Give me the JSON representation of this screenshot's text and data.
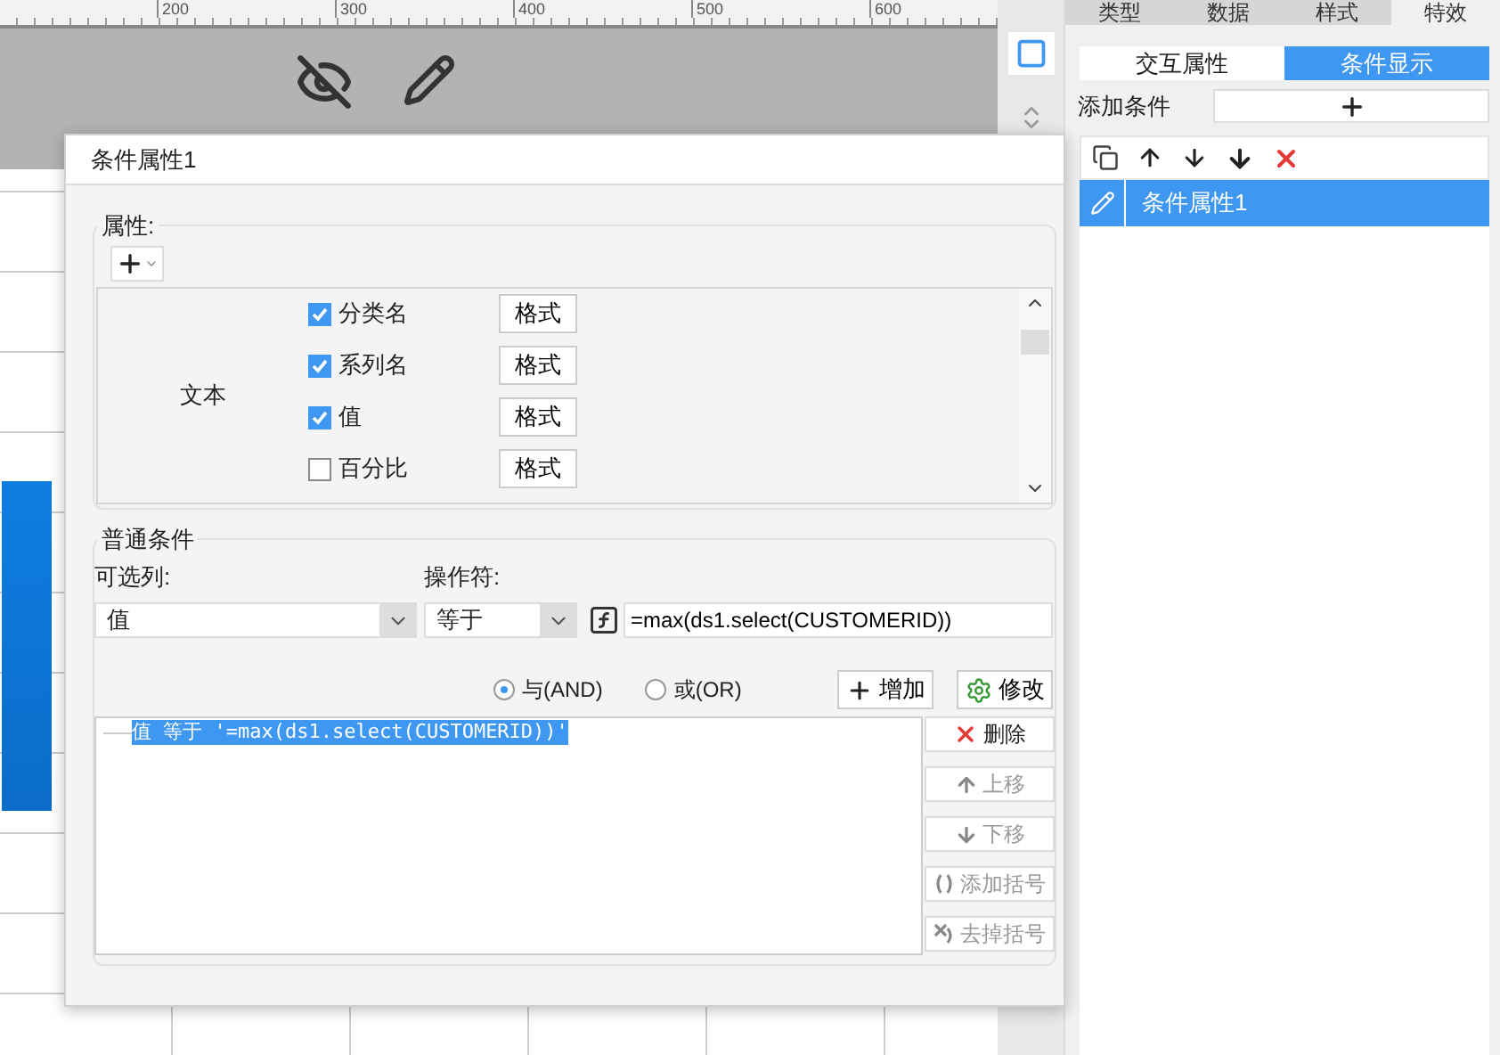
{
  "ruler": {
    "labels": [
      "200",
      "300",
      "400",
      "500",
      "600"
    ]
  },
  "panel": {
    "tabs": [
      {
        "label": "类型",
        "selected": false
      },
      {
        "label": "数据",
        "selected": false
      },
      {
        "label": "样式",
        "selected": false
      },
      {
        "label": "特效",
        "selected": true
      }
    ],
    "sub_tabs": [
      {
        "label": "交互属性",
        "selected": false
      },
      {
        "label": "条件显示",
        "selected": true
      }
    ],
    "add_label": "添加条件",
    "conditions": [
      {
        "label": "条件属性1",
        "selected": true
      }
    ]
  },
  "dialog": {
    "title": "条件属性1",
    "properties": {
      "legend": "属性:",
      "group": "文本",
      "items": [
        {
          "label": "分类名",
          "checked": true,
          "button": "格式"
        },
        {
          "label": "系列名",
          "checked": true,
          "button": "格式"
        },
        {
          "label": "值",
          "checked": true,
          "button": "格式"
        },
        {
          "label": "百分比",
          "checked": false,
          "button": "格式"
        }
      ]
    },
    "condition": {
      "legend": "普通条件",
      "column_label": "可选列:",
      "column_value": "值",
      "operator_label": "操作符:",
      "operator_value": "等于",
      "formula": "=max(ds1.select(CUSTOMERID))",
      "logic": [
        {
          "label": "与(AND)",
          "selected": true
        },
        {
          "label": "或(OR)",
          "selected": false
        }
      ],
      "actions": [
        "增加",
        "修改"
      ],
      "entries": [
        {
          "text": "值 等于 '=max(ds1.select(CUSTOMERID))'",
          "selected": true
        }
      ],
      "side_buttons": [
        {
          "label": "删除",
          "disabled": false
        },
        {
          "label": "上移",
          "disabled": true
        },
        {
          "label": "下移",
          "disabled": true
        },
        {
          "label": "添加括号",
          "disabled": true
        },
        {
          "label": "去掉括号",
          "disabled": true
        }
      ]
    }
  }
}
